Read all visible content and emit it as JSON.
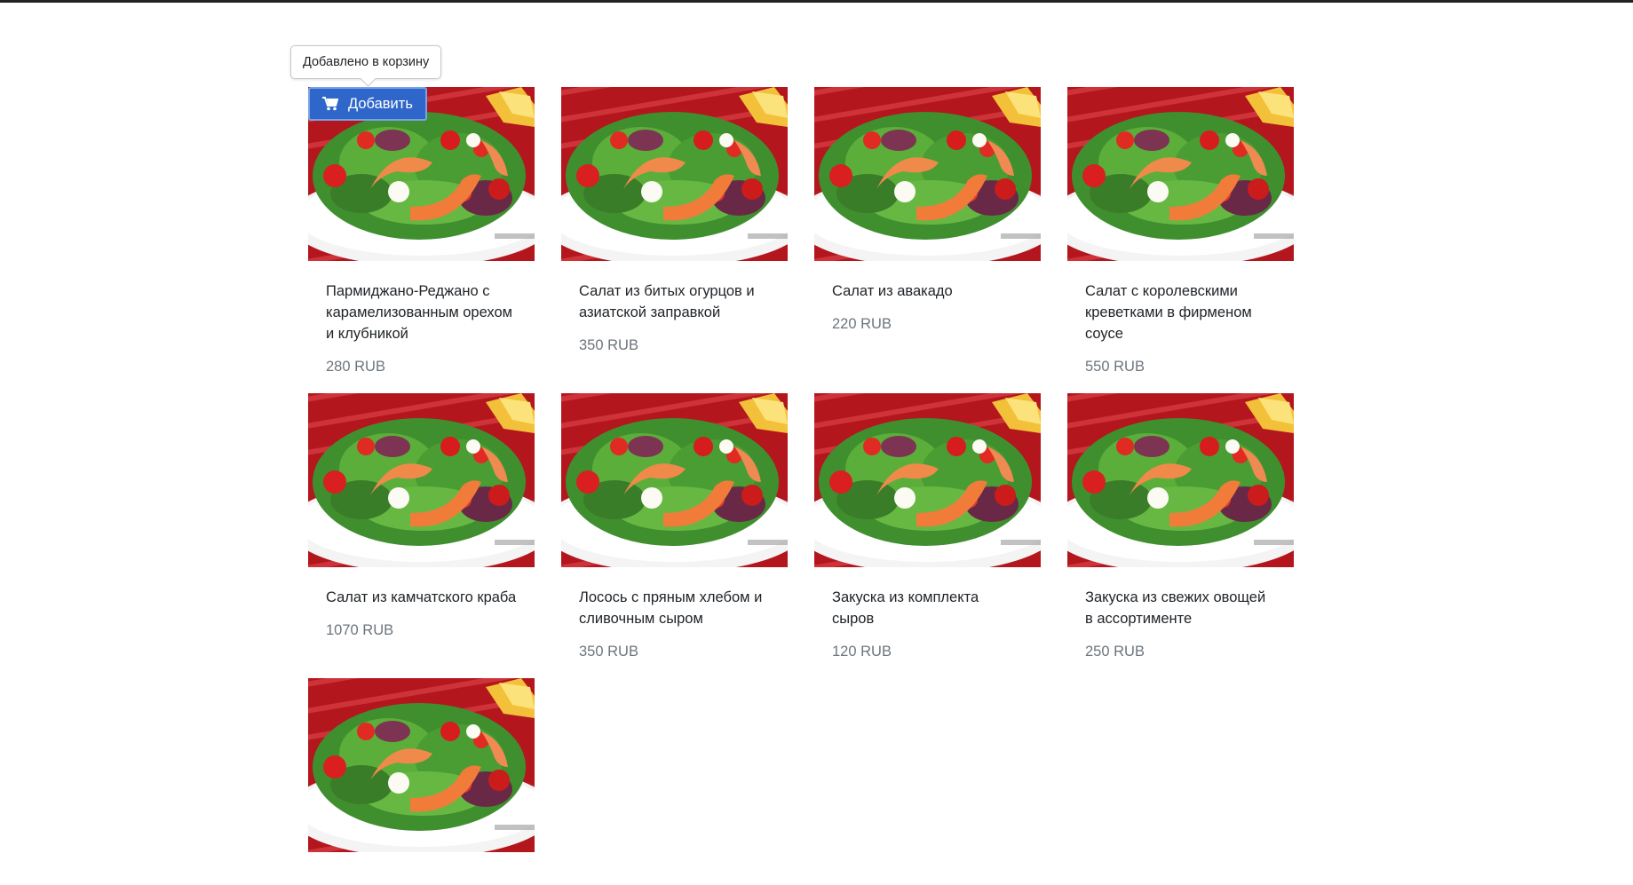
{
  "colors": {
    "add_button": "#2f66c9",
    "price_text": "#6c757d",
    "title_text": "#212529"
  },
  "tooltip": {
    "text": "Добавлено в корзину"
  },
  "add_button": {
    "label": "Добавить",
    "icon": "shopping-cart-icon"
  },
  "products": [
    {
      "title": "Пармиджано-Реджано с карамелизованным орехом и клубникой",
      "price": "280 RUB",
      "image": "salad-image"
    },
    {
      "title": "Салат из битых огурцов и азиатской заправкой",
      "price": "350 RUB",
      "image": "salad-image"
    },
    {
      "title": "Салат из авакадо",
      "price": "220 RUB",
      "image": "salad-image"
    },
    {
      "title": "Салат с королевскими креветками в фирменом соусе",
      "price": "550 RUB",
      "image": "salad-image"
    },
    {
      "title": "Салат из камчатского краба",
      "price": "1070 RUB",
      "image": "salad-image"
    },
    {
      "title": "Лосось с пряным хлебом и сливочным сыром",
      "price": "350 RUB",
      "image": "salad-image"
    },
    {
      "title": "Закуска из комплекта сыров",
      "price": "120 RUB",
      "image": "salad-image"
    },
    {
      "title": "Закуска из свежих овощей в ассортименте",
      "price": "250 RUB",
      "image": "salad-image"
    },
    {
      "title": "",
      "price": "",
      "image": "salad-image"
    }
  ]
}
